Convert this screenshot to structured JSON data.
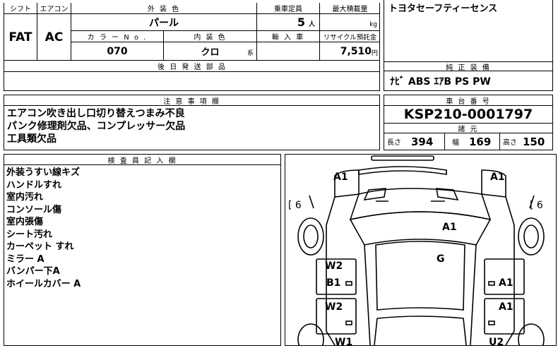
{
  "spec": {
    "shift_header": "シフト",
    "aircon_header": "エアコン",
    "shift_value": "FAT",
    "aircon_value": "AC",
    "exterior_color_header": "外 装 色",
    "exterior_color_value": "パール",
    "color_no_header": "カ ラ ー N o .",
    "color_no_value": "070",
    "interior_color_header": "内 装 色",
    "interior_color_value": "クロ",
    "interior_color_suffix": "系",
    "capacity_header": "乗車定員",
    "capacity_value": "5",
    "capacity_unit": "人",
    "max_load_header": "最大積載量",
    "max_load_unit": "kg",
    "import_header": "輸 入 車",
    "recycle_header": "リサイクル預託金",
    "recycle_value": "7,510",
    "recycle_unit": "円",
    "later_parts_header": "後 日 発 送 部 品"
  },
  "features": {
    "top_text": "トヨタセーフティーセンス",
    "standard_header": "純 正 装 備",
    "standard_value": "ﾅﾋﾞ ABS ｴｱB PS PW"
  },
  "notes": {
    "header": "注 意 事 項 欄",
    "lines": [
      "エアコン吹き出し口切り替えつまみ不良",
      "パンク修理剤欠品、コンプレッサー欠品",
      "工具類欠品"
    ]
  },
  "chassis": {
    "header": "車 台 番 号",
    "value": "KSP210-0001797",
    "dims_header": "諸 元",
    "length_label": "長さ",
    "length_value": "394",
    "width_label": "幅",
    "width_value": "169",
    "height_label": "高さ",
    "height_value": "150"
  },
  "inspector": {
    "header": "検 査 員 記 入 欄",
    "lines": [
      "外装うすい線キズ",
      "ハンドルすれ",
      "室内汚れ",
      "コンソール傷",
      "室内張傷",
      "シート汚れ",
      "カーペット すれ",
      "ミラー A",
      "バンパー下A",
      "ホイールカバー A"
    ]
  },
  "diagram": {
    "left_tire": "[ 6",
    "right_tire": "[ 6",
    "labels": {
      "front_left": "A1",
      "front_right": "A1",
      "hood": "A1",
      "roof": "G",
      "left_front_door_1": "W2",
      "left_front_door_2": "B1",
      "right_front_door": "A1",
      "left_rear_door": "W2",
      "right_rear_door": "A1",
      "rear_left": "W1",
      "rear_right": "U2"
    }
  }
}
